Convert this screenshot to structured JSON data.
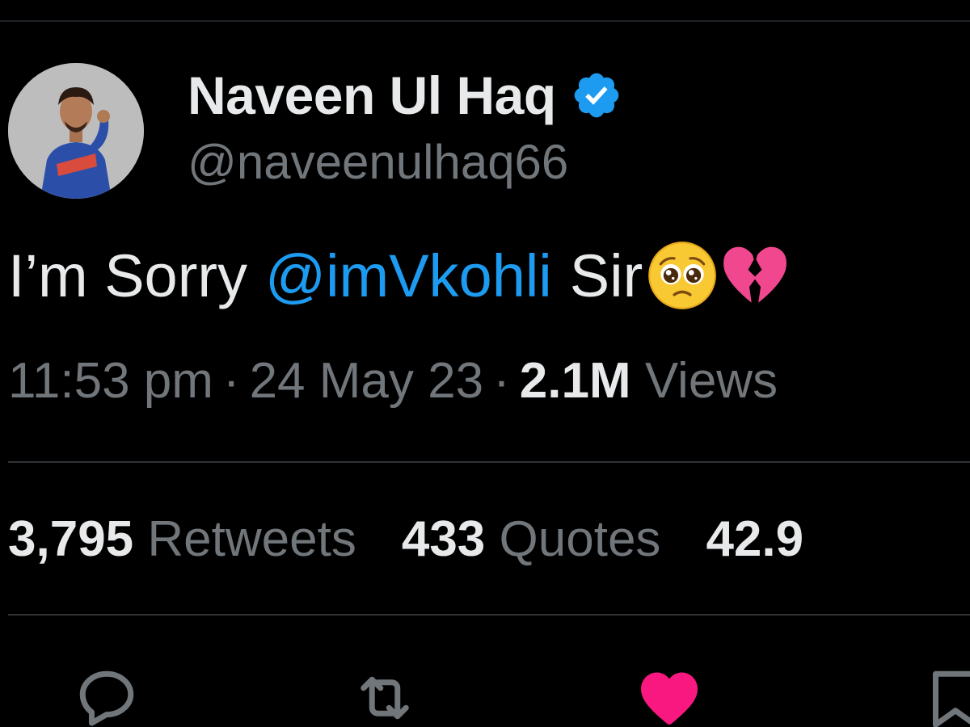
{
  "author": {
    "display_name": "Naveen Ul Haq",
    "handle": "@naveenulhaq66",
    "verified_icon": "verified-badge-icon"
  },
  "tweet": {
    "text_before": "I’m Sorry",
    "mention": "@imVkohli",
    "text_after": "Sir",
    "emojis": [
      "pleading-face-emoji",
      "broken-heart-emoji"
    ]
  },
  "meta": {
    "time": "11:53 pm",
    "date": "24 May 23",
    "separator": "·",
    "views_count": "2.1M",
    "views_label": "Views"
  },
  "stats": {
    "retweets_count": "3,795",
    "retweets_label": "Retweets",
    "quotes_count": "433",
    "quotes_label": "Quotes",
    "likes_count_partial": "42.9"
  },
  "actions": [
    {
      "name": "reply",
      "icon": "reply-icon"
    },
    {
      "name": "retweet",
      "icon": "retweet-icon"
    },
    {
      "name": "like",
      "icon": "heart-icon",
      "active": true
    },
    {
      "name": "bookmark",
      "icon": "bookmark-icon"
    }
  ],
  "colors": {
    "background": "#000000",
    "primary_text": "#e7e9ea",
    "secondary_text": "#71767b",
    "link": "#1d9bf0",
    "like_active": "#f91880"
  }
}
